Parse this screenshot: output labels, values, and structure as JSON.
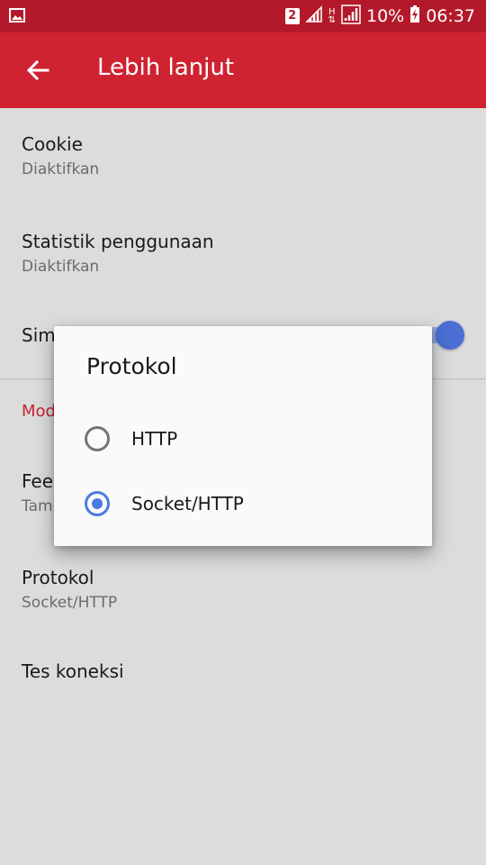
{
  "status_bar": {
    "sim_slot": "2",
    "network_type": "H",
    "battery": "10%",
    "time": "06:37",
    "icons": [
      "gallery-notification-icon",
      "signal-icon",
      "data-arrows-icon",
      "battery-charging-icon"
    ]
  },
  "appbar": {
    "title": "Lebih lanjut",
    "back_icon": "arrow-left-icon"
  },
  "settings": {
    "cookie": {
      "title": "Cookie",
      "summary": "Diaktifkan"
    },
    "stats": {
      "title": "Statistik penggunaan",
      "summary": "Diaktifkan"
    },
    "sim_partial": "Sim",
    "section_partial": "Mod",
    "feed_partial": {
      "title": "Fee",
      "summary": "Tam"
    },
    "protocol": {
      "title": "Protokol",
      "summary": "Socket/HTTP"
    },
    "test": {
      "title": "Tes koneksi"
    }
  },
  "dialog": {
    "title": "Protokol",
    "options": [
      {
        "label": "HTTP",
        "selected": false
      },
      {
        "label": "Socket/HTTP",
        "selected": true
      }
    ]
  },
  "colors": {
    "status_bar": "#b3192a",
    "app_bar": "#cf2331",
    "accent": "#4b7be0",
    "section_header": "#c8202e"
  }
}
